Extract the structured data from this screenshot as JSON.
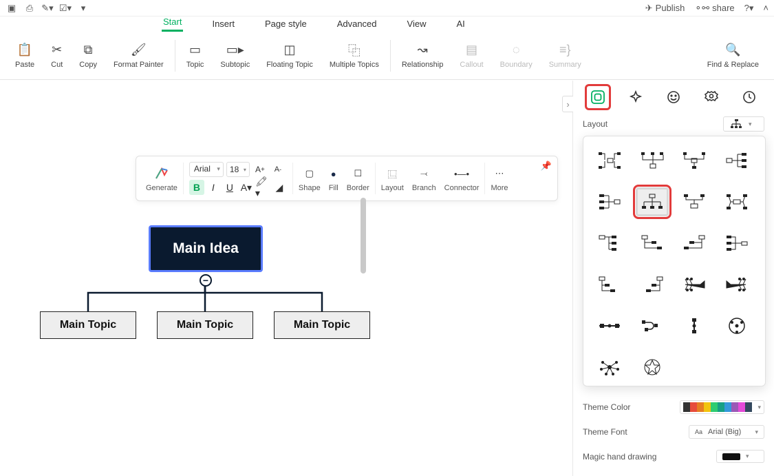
{
  "topbar": {
    "publish": "Publish",
    "share": "share"
  },
  "menu": {
    "tabs": [
      "Start",
      "Insert",
      "Page style",
      "Advanced",
      "View",
      "AI"
    ],
    "active": "Start"
  },
  "ribbon": {
    "paste": "Paste",
    "cut": "Cut",
    "copy": "Copy",
    "format": "Format Painter",
    "topic": "Topic",
    "subtopic": "Subtopic",
    "floating": "Floating Topic",
    "multiple": "Multiple Topics",
    "relationship": "Relationship",
    "callout": "Callout",
    "boundary": "Boundary",
    "summary": "Summary",
    "find": "Find & Replace"
  },
  "floatbar": {
    "generate": "Generate",
    "font": "Arial",
    "size": "18",
    "shape": "Shape",
    "fill": "Fill",
    "border": "Border",
    "layout": "Layout",
    "branch": "Branch",
    "connector": "Connector",
    "more": "More"
  },
  "mindmap": {
    "main": "Main Idea",
    "topics": [
      "Main Topic",
      "Main Topic",
      "Main Topic"
    ]
  },
  "panel": {
    "layout_label": "Layout",
    "theme_color": "Theme Color",
    "theme_font": "Theme Font",
    "theme_font_value": "Arial (Big)",
    "magic": "Magic hand drawing"
  }
}
